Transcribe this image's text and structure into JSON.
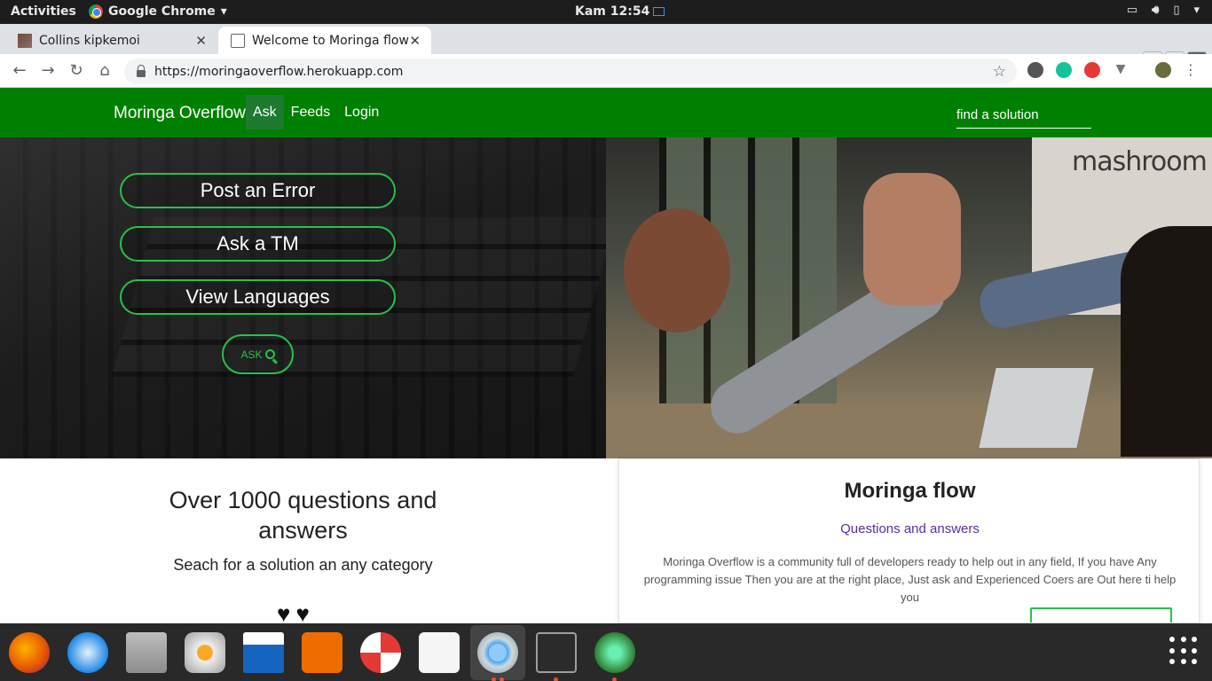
{
  "system_bar": {
    "activities": "Activities",
    "app_name": "Google Chrome",
    "clock": "Kam 12:54"
  },
  "browser": {
    "tabs": [
      {
        "title": "Collins kipkemoi",
        "active": false
      },
      {
        "title": "Welcome to Moringa flow",
        "active": true
      }
    ],
    "url": "https://moringaoverflow.herokuapp.com"
  },
  "site_nav": {
    "brand": "Moringa Overflow",
    "links": [
      "Ask",
      "Feeds",
      "Login"
    ],
    "search_placeholder": "find a solution"
  },
  "hero": {
    "buttons": [
      "Post an Error",
      "Ask a TM",
      "View Languages"
    ],
    "ask_button": "ASK",
    "wall_text": "mashroom"
  },
  "stats_section": {
    "heading_line1": "Over 1000 questions and",
    "heading_line2": "answers",
    "subtext": "Seach for a solution an any category",
    "hearts": "♥♥"
  },
  "info_card": {
    "title": "Moringa flow",
    "subtitle": "Questions and answers",
    "description": "Moringa Overflow is a community full of developers ready to help out in any field, If you have Any programming issue Then you are at the right place, Just ask and Experienced Coers are Out here ti help you"
  },
  "colors": {
    "site_green": "#008000",
    "accent_green": "#26c24a",
    "subtitle_purple": "#5a2aa8"
  },
  "dock_apps": [
    "firefox-icon",
    "thunderbird-icon",
    "files-icon",
    "rhythmbox-icon",
    "writer-icon",
    "software-icon",
    "help-icon",
    "amazon-icon",
    "chrome-icon",
    "terminal-icon",
    "atom-icon"
  ]
}
